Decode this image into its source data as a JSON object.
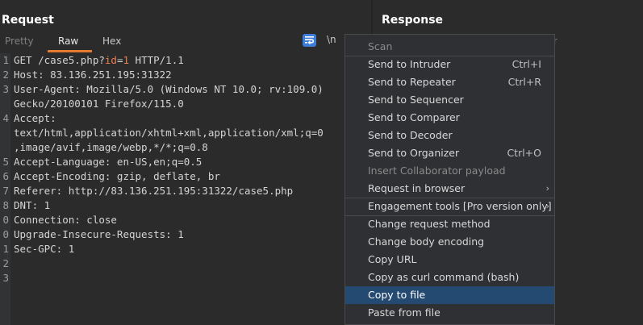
{
  "request": {
    "title": "Request",
    "tabs": [
      "Pretty",
      "Raw",
      "Hex"
    ],
    "newline_label": "\\n",
    "lines": [
      {
        "num": "1",
        "pre": "GET /case5.php?",
        "param": "id",
        "eq": "=",
        "val": "1",
        "post": " HTTP/1.1"
      },
      {
        "num": "2",
        "text": "Host: 83.136.251.195:31322"
      },
      {
        "num": "3",
        "text": "User-Agent: Mozilla/5.0 (Windows NT 10.0; rv:109.0)"
      },
      {
        "num": "",
        "text": "Gecko/20100101 Firefox/115.0"
      },
      {
        "num": "4",
        "text": "Accept:"
      },
      {
        "num": "",
        "text": "text/html,application/xhtml+xml,application/xml;q=0"
      },
      {
        "num": "",
        "text": ",image/avif,image/webp,*/*;q=0.8"
      },
      {
        "num": "5",
        "text": "Accept-Language: en-US,en;q=0.5"
      },
      {
        "num": "6",
        "text": "Accept-Encoding: gzip, deflate, br"
      },
      {
        "num": "7",
        "text": "Referer: http://83.136.251.195:31322/case5.php"
      },
      {
        "num": "8",
        "text": "DNT: 1"
      },
      {
        "num": "0",
        "text": "Connection: close"
      },
      {
        "num": "0",
        "text": "Upgrade-Insecure-Requests: 1"
      },
      {
        "num": "1",
        "text": "Sec-GPC: 1"
      },
      {
        "num": "2",
        "text": ""
      },
      {
        "num": "3",
        "text": ""
      }
    ]
  },
  "response": {
    "title": "Response",
    "partial_tab": "r"
  },
  "context_menu": {
    "items": [
      {
        "label": "Scan",
        "shortcut": "",
        "disabled": true
      },
      {
        "sep": true
      },
      {
        "label": "Send to Intruder",
        "shortcut": "Ctrl+I"
      },
      {
        "label": "Send to Repeater",
        "shortcut": "Ctrl+R"
      },
      {
        "label": "Send to Sequencer",
        "shortcut": ""
      },
      {
        "label": "Send to Comparer",
        "shortcut": ""
      },
      {
        "label": "Send to Decoder",
        "shortcut": ""
      },
      {
        "label": "Send to Organizer",
        "shortcut": "Ctrl+O"
      },
      {
        "label": "Insert Collaborator payload",
        "shortcut": "",
        "disabled": true
      },
      {
        "label": "Request in browser",
        "shortcut": "",
        "submenu": true
      },
      {
        "sep": true
      },
      {
        "label": "Engagement tools [Pro version only]",
        "shortcut": "",
        "submenu": true
      },
      {
        "sep": true
      },
      {
        "label": "Change request method",
        "shortcut": ""
      },
      {
        "label": "Change body encoding",
        "shortcut": ""
      },
      {
        "label": "Copy URL",
        "shortcut": ""
      },
      {
        "label": "Copy as curl command (bash)",
        "shortcut": ""
      },
      {
        "label": "Copy to file",
        "shortcut": "",
        "selected": true
      },
      {
        "label": "Paste from file",
        "shortcut": ""
      }
    ]
  },
  "colors": {
    "accent": "#e57b31",
    "param_highlight": "#ec7f4e",
    "selection": "#254a72",
    "wrap_button": "#3b7dd8"
  }
}
